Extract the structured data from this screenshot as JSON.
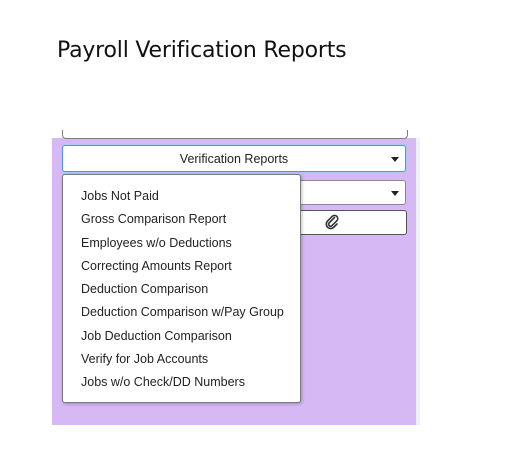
{
  "page_title": "Payroll Verification Reports",
  "report_select": {
    "selected": "Verification Reports"
  },
  "attach_button": {
    "icon": "paperclip-icon"
  },
  "dropdown": {
    "items": [
      "Jobs Not Paid",
      "Gross Comparison Report",
      "Employees w/o Deductions",
      "Correcting Amounts Report",
      "Deduction Comparison",
      "Deduction Comparison w/Pay Group",
      "Job Deduction Comparison",
      "Verify for Job Accounts",
      "Jobs w/o Check/DD Numbers"
    ]
  },
  "colors": {
    "panel_background": "#d6b8f4",
    "focus_border": "#4d90fe"
  }
}
